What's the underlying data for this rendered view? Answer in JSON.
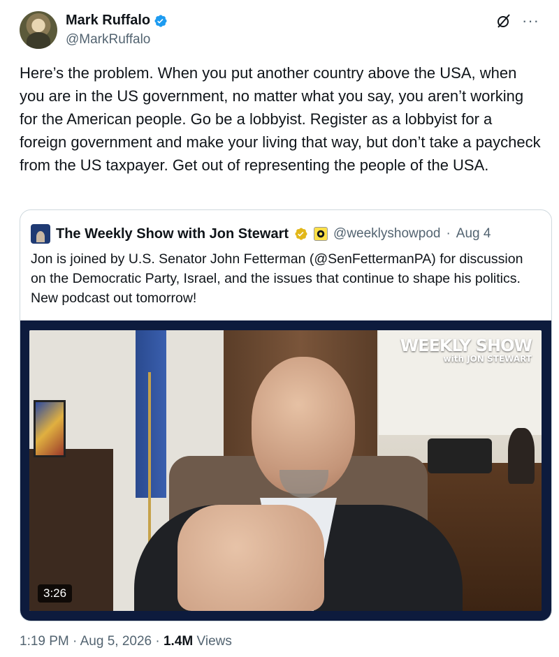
{
  "author": {
    "name": "Mark Ruffalo",
    "handle": "@MarkRuffalo",
    "verified_color": "#1d9bf0"
  },
  "tweet": {
    "text": "Here’s the problem. When you put another country above the USA, when you are in the US government, no matter what you say, you aren’t working for the American people. Go be a lobbyist. Register as a lobbyist for a foreign government and make your living that way, but don’t take a paycheck from the US taxpayer. Get out of representing the people of the USA."
  },
  "quote": {
    "name": "The Weekly Show with Jon Stewart",
    "handle": "@weeklyshowpod",
    "separator": "·",
    "date": "Aug 4",
    "text": "Jon is joined by U.S. Senator John Fetterman (@SenFettermanPA) for discussion on the Democratic Party, Israel, and the issues that continue to shape his politics. New podcast out tomorrow!",
    "verified_color": "#e2b719",
    "video": {
      "duration": "3:26",
      "logo_main": "WEEKLY SHOW",
      "logo_sub": "with JON STEWART"
    }
  },
  "footer": {
    "time": "1:19 PM",
    "date": "Aug 5, 2026",
    "views_count": "1.4M",
    "views_label": "Views"
  },
  "icons": {
    "grok": "grok-icon",
    "more": "more-icon",
    "verified": "verified-badge-icon"
  }
}
